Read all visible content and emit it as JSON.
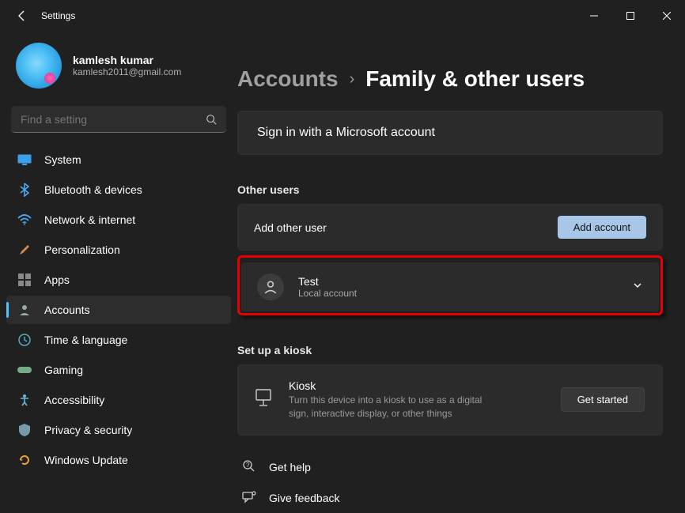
{
  "window": {
    "title": "Settings"
  },
  "user": {
    "name": "kamlesh kumar",
    "email": "kamlesh2011@gmail.com"
  },
  "search": {
    "placeholder": "Find a setting"
  },
  "nav": {
    "items": [
      {
        "label": "System"
      },
      {
        "label": "Bluetooth & devices"
      },
      {
        "label": "Network & internet"
      },
      {
        "label": "Personalization"
      },
      {
        "label": "Apps"
      },
      {
        "label": "Accounts"
      },
      {
        "label": "Time & language"
      },
      {
        "label": "Gaming"
      },
      {
        "label": "Accessibility"
      },
      {
        "label": "Privacy & security"
      },
      {
        "label": "Windows Update"
      }
    ]
  },
  "breadcrumb": {
    "parent": "Accounts",
    "current": "Family & other users"
  },
  "signin_card": {
    "text": "Sign in with a Microsoft account"
  },
  "other_users": {
    "heading": "Other users",
    "add_label": "Add other user",
    "add_button": "Add account",
    "user": {
      "name": "Test",
      "type": "Local account"
    }
  },
  "kiosk": {
    "heading": "Set up a kiosk",
    "title": "Kiosk",
    "desc": "Turn this device into a kiosk to use as a digital sign, interactive display, or other things",
    "button": "Get started"
  },
  "links": {
    "help": "Get help",
    "feedback": "Give feedback"
  }
}
